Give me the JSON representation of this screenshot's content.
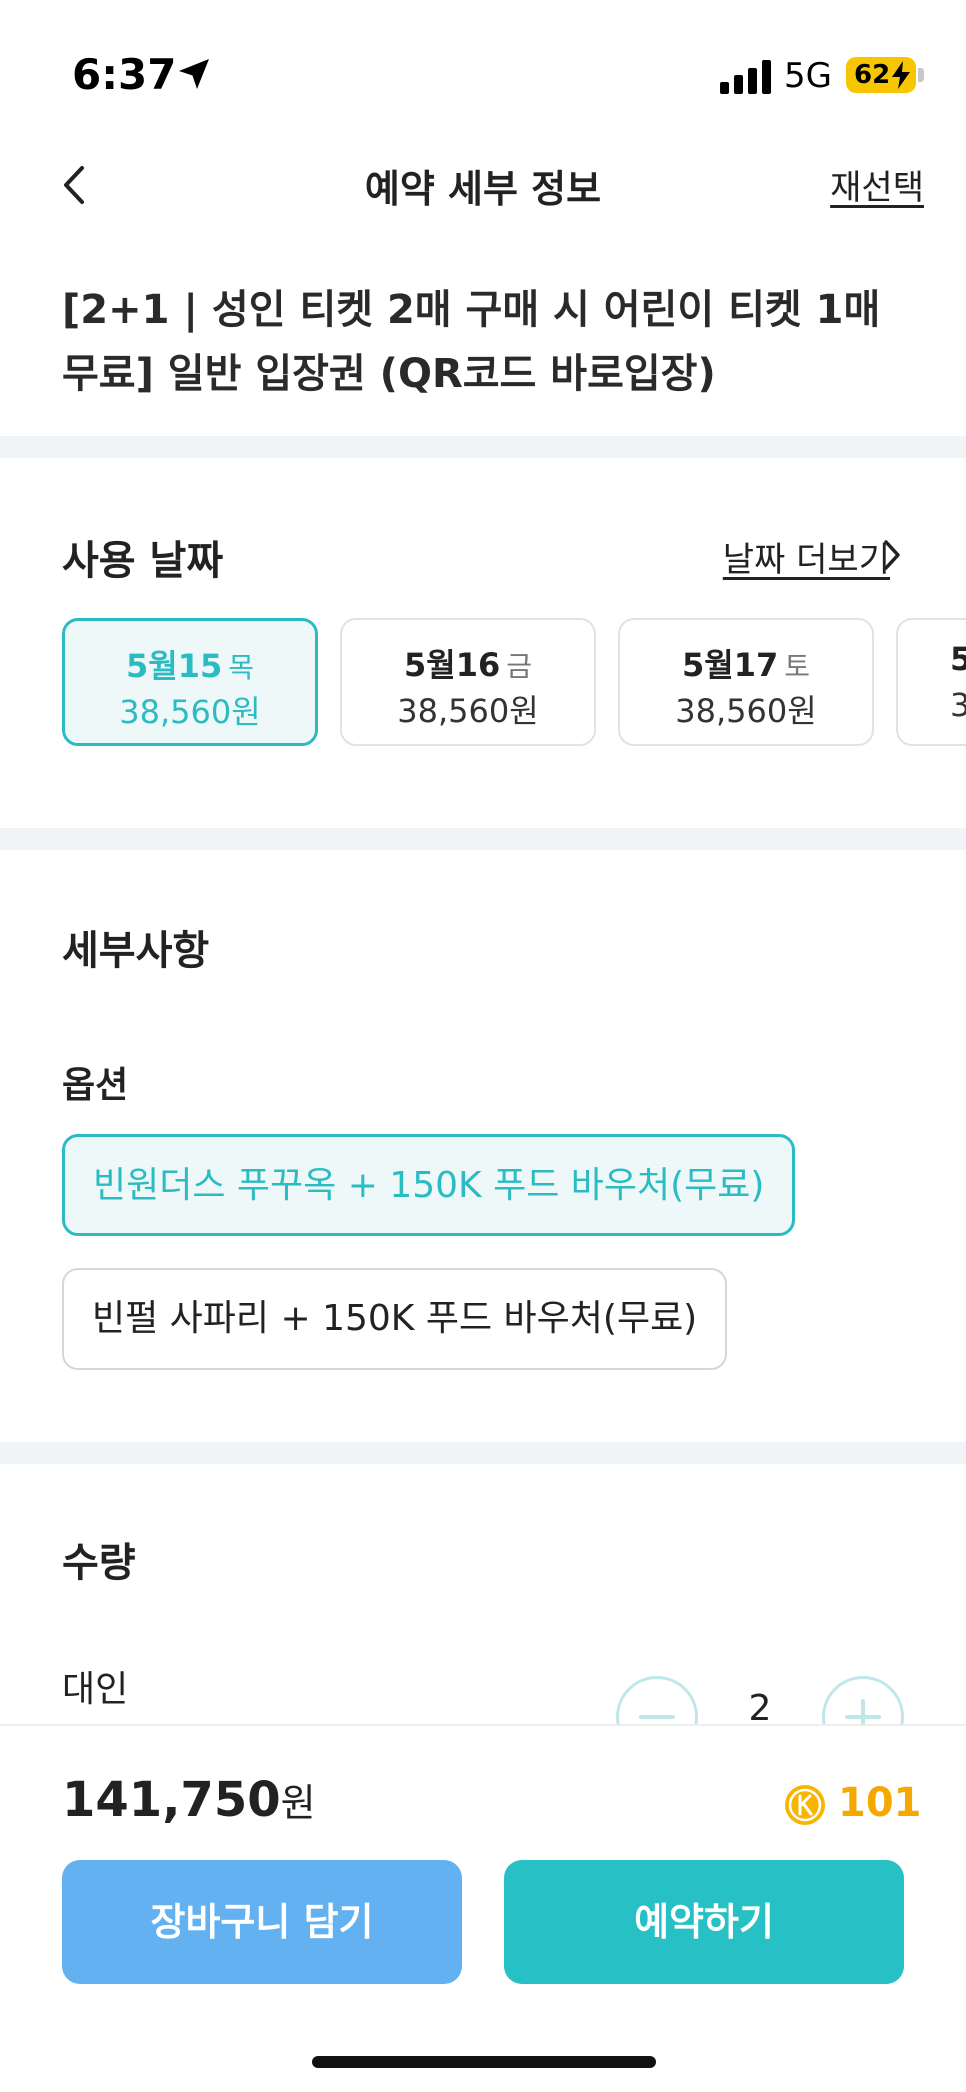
{
  "status_bar": {
    "time": "6:37",
    "network": "5G",
    "battery": "62"
  },
  "header": {
    "title": "예약 세부 정보",
    "reselect": "재선택"
  },
  "product_title": "[2+1 | 성인 티켓 2매 구매 시 어린이 티켓 1매 무료] 일반 입장권 (QR코드 바로입장)",
  "date_section": {
    "heading": "사용 날짜",
    "more_label": "날짜 더보기",
    "dates": [
      {
        "date": "5월15",
        "dow": "목",
        "price": "38,560원",
        "selected": true
      },
      {
        "date": "5월16",
        "dow": "금",
        "price": "38,560원",
        "selected": false
      },
      {
        "date": "5월17",
        "dow": "토",
        "price": "38,560원",
        "selected": false
      },
      {
        "date": "5",
        "dow": "",
        "price": "3",
        "selected": false
      }
    ]
  },
  "details": {
    "heading": "세부사항",
    "option_heading": "옵션",
    "options": [
      {
        "label": "빈원더스 푸꾸옥 + 150K 푸드 바우처(무료)",
        "selected": true
      },
      {
        "label": "빈펄 사파리 + 150K 푸드 바우처(무료)",
        "selected": false
      }
    ]
  },
  "quantity": {
    "heading": "수량",
    "adult_label": "대인",
    "adult_count": "2"
  },
  "bottom": {
    "total_amount": "141,750",
    "total_unit": "원",
    "points": "101",
    "cart_label": "장바구니 담기",
    "reserve_label": "예약하기"
  },
  "colors": {
    "accent": "#2bbcc3",
    "cart": "#64b1f2",
    "reserve": "#27c0c4",
    "points": "#f4a800"
  },
  "icons": [
    "location-arrow-icon",
    "signal-icon",
    "battery-icon",
    "back-icon",
    "chevron-right-icon",
    "minus-icon",
    "plus-icon",
    "coin-icon"
  ]
}
